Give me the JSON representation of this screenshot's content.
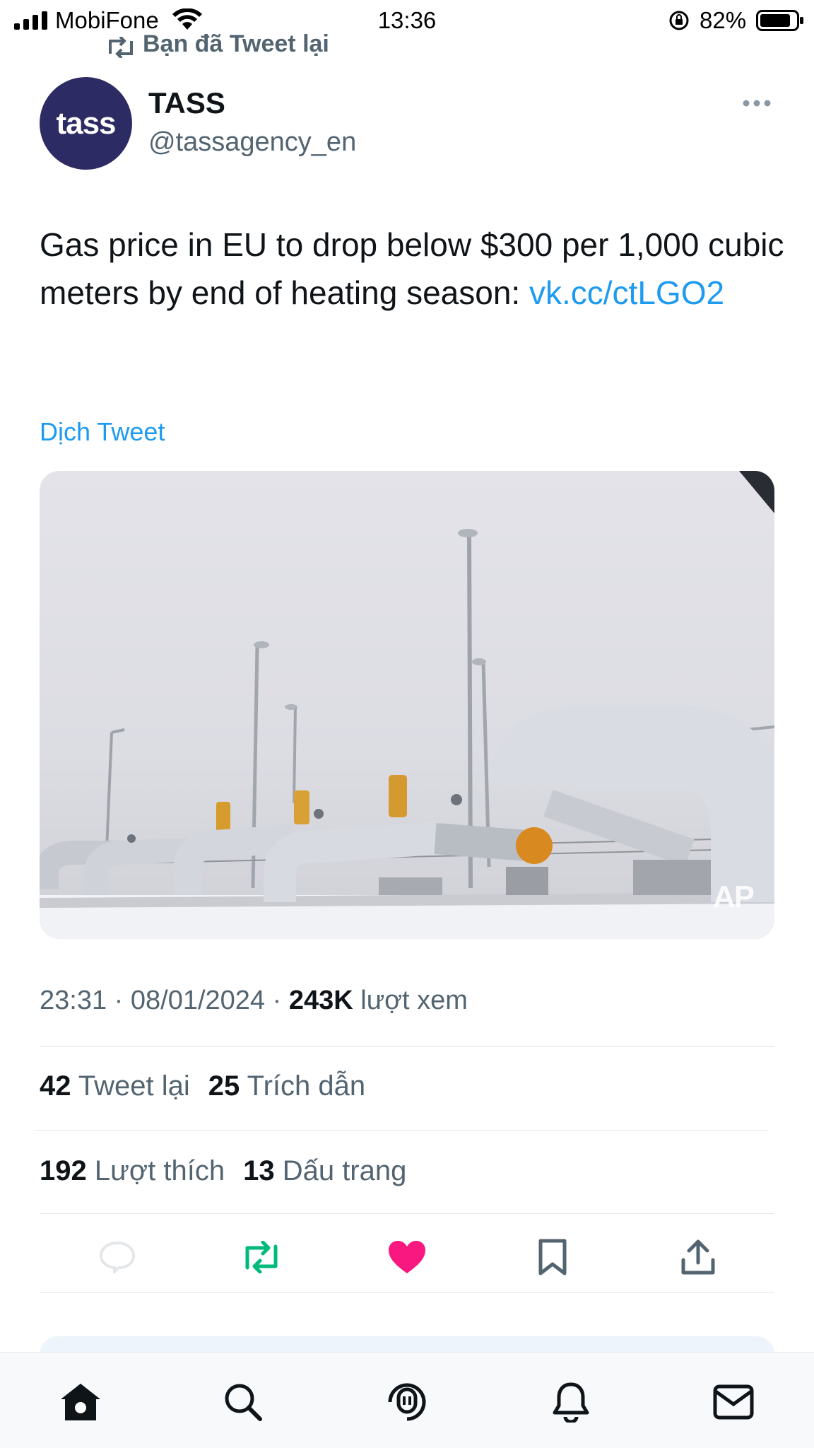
{
  "status_bar": {
    "carrier": "MobiFone",
    "time": "13:36",
    "battery": "82%"
  },
  "social_context": {
    "label": "Bạn đã Tweet lại"
  },
  "author": {
    "avatar_text": "tass",
    "name": "TASS",
    "handle": "@tassagency_en"
  },
  "tweet": {
    "text": "Gas price in EU to drop below $300 per 1,000 cubic meters by end of heating season:",
    "link": "vk.cc/ctLGO2",
    "translate_label": "Dịch Tweet",
    "media_credit": "AP"
  },
  "meta": {
    "time": "23:31",
    "separator": "·",
    "date": "08/01/2024",
    "views_count": "243K",
    "views_label": "lượt xem"
  },
  "stats": {
    "retweets_count": "42",
    "retweets_label": "Tweet lại",
    "quotes_count": "25",
    "quotes_label": "Trích dẫn",
    "likes_count": "192",
    "likes_label": "Lượt thích",
    "bookmarks_count": "13",
    "bookmarks_label": "Dấu trang"
  },
  "actions": [
    "reply-icon",
    "retweet-icon",
    "like-icon",
    "bookmark-icon",
    "share-icon"
  ],
  "tab_bar": [
    "home-icon",
    "search-icon",
    "spaces-icon",
    "notifications-icon",
    "messages-icon"
  ],
  "colors": {
    "link": "#1d9bf0",
    "retweet_active": "#00ba7c",
    "like_active": "#f91880",
    "avatar_bg": "#2d2b63"
  }
}
